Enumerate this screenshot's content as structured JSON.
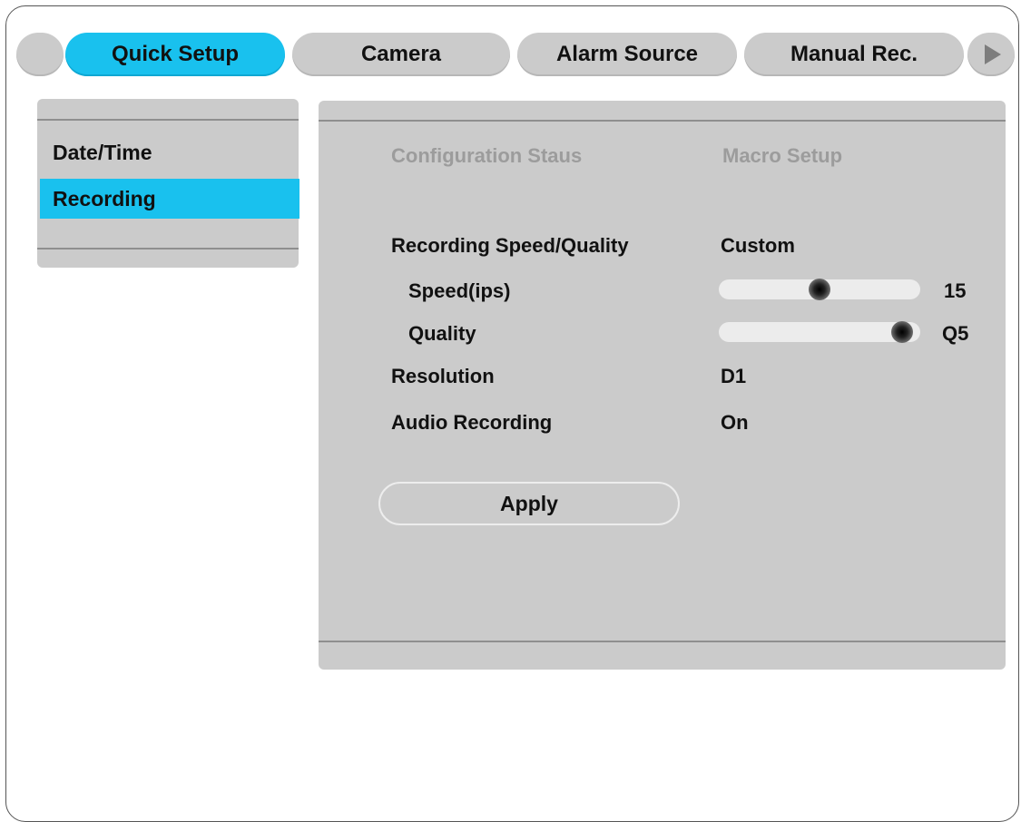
{
  "tabs": [
    {
      "label": "Quick Setup",
      "active": true
    },
    {
      "label": "Camera",
      "active": false
    },
    {
      "label": "Alarm Source",
      "active": false
    },
    {
      "label": "Manual Rec.",
      "active": false
    }
  ],
  "side_menu": {
    "items": [
      {
        "label": "Date/Time",
        "active": false
      },
      {
        "label": "Recording",
        "active": true
      }
    ]
  },
  "main": {
    "header_left": "Configuration Staus",
    "header_right": "Macro Setup",
    "rows": {
      "speed_quality": {
        "label": "Recording Speed/Quality",
        "value": "Custom"
      },
      "speed": {
        "label": "Speed(ips)",
        "value": "15",
        "level": 0.5
      },
      "quality": {
        "label": "Quality",
        "value": "Q5",
        "level": 0.91
      },
      "resolution": {
        "label": "Resolution",
        "value": "D1"
      },
      "audio": {
        "label": "Audio Recording",
        "value": "On"
      }
    },
    "apply_label": "Apply"
  },
  "colors": {
    "accent": "#19c1ee",
    "panel": "#cbcbcb",
    "disabled_text": "#9c9c9c"
  }
}
